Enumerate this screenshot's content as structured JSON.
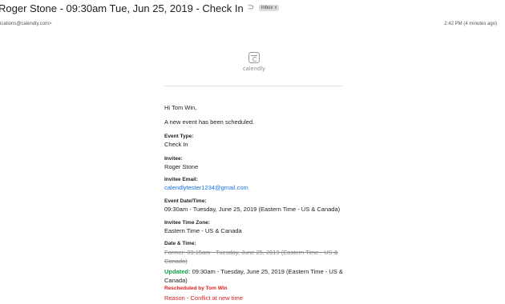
{
  "header": {
    "subject": "Roger Stone - 09:30am Tue, Jun 25, 2019 - Check In",
    "label_chip": "Inbox",
    "label_chip_close": "x"
  },
  "meta": {
    "sender": "ications@calendly.com>",
    "timestamp": "2:42 PM (4 minutes ago)"
  },
  "logo": {
    "text": "calendly"
  },
  "email": {
    "greeting": "Hi Tom Win,",
    "intro": "A new event has been scheduled.",
    "event_type_label": "Event Type:",
    "event_type_value": "Check In",
    "invitee_label": "Invitee:",
    "invitee_value": "Roger Stone",
    "invitee_email_label": "Invitee Email:",
    "invitee_email_value": "calendlytester1234@gmail.com",
    "event_datetime_label": "Event Date/Time:",
    "event_datetime_value": "09:30am - Tuesday, June 25, 2019 (Eastern Time - US & Canada)",
    "invitee_tz_label": "Invitee Time Zone:",
    "invitee_tz_value": "Eastern Time - US & Canada",
    "date_time_label": "Date & Time:",
    "former_text": "Former: 09:15am - Tuesday, June 25, 2019 (Eastern Time - US & Canada)",
    "updated_label": "Updated:",
    "updated_text": " 09:30am - Tuesday, June 25, 2019 (Eastern Time - US & Canada)",
    "rescheduled_by": "Rescheduled by Tom Win",
    "reason": "Reason - Conflict at new time"
  },
  "colors": {
    "link": "#1a73e8",
    "updated": "#14a04a",
    "alert": "#dd2222"
  }
}
